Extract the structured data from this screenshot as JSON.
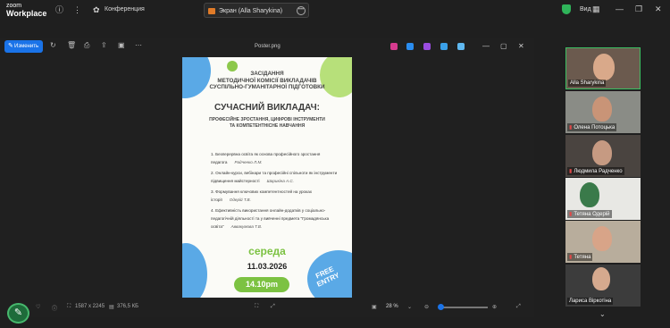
{
  "topbar": {
    "brand_line1": "zoom",
    "brand_line2": "Workplace",
    "conference_label": "Конференция",
    "tab_label": "Экран (Alla Sharykina)",
    "view_label": "Вид"
  },
  "viewer": {
    "edit_label": "Изменить",
    "file_title": "Poster.png",
    "dimensions": "1587 x 2245",
    "file_size": "376,5 КБ",
    "zoom_level": "28 %",
    "zoom_fraction": 0.28
  },
  "poster": {
    "heading_lines": [
      "ЗАСІДАННЯ",
      "МЕТОДИЧНОЇ КОМІСІЇ ВИКЛАДАЧІВ",
      "СУСПІЛЬНО-ГУМАНІТАРНОЇ ПІДГОТОВКИ"
    ],
    "title": "СУЧАСНИЙ ВИКЛАДАЧ:",
    "subtitle_lines": [
      "ПРОФЕСІЙНЕ ЗРОСТАННЯ, ЦИФРОВІ ІНСТРУМЕНТИ",
      "ТА КОМПЕТЕНТНІСНЕ НАВЧАННЯ"
    ],
    "items": [
      {
        "text": "1. Безперервна освіта як основа професійного зростання педагога",
        "sign": "Радченко Л.М."
      },
      {
        "text": "2. Онлайн-курси, вебінари та професійні спільноти як інструменти підвищення майстерності",
        "sign": "Шарикіна А.С."
      },
      {
        "text": "3. Формування ключових компетентностей на уроках історії",
        "sign": "Одерій Т.В."
      },
      {
        "text": "4. Ефективність використання онлайн-додатків у соціально-педагогічній діяльності та у вивченні предмета \"Громадянська освіта\"",
        "sign": "Аввакумова Т.В."
      }
    ],
    "day": "середа",
    "date": "11.03.2026",
    "time": "14.10pm",
    "badge_line1": "FREE",
    "badge_line2": "ENTRY"
  },
  "participants": [
    {
      "name": "Alla Sharykina",
      "muted": false
    },
    {
      "name": "Олена Потоцька",
      "muted": true
    },
    {
      "name": "Людмила Радченко",
      "muted": true
    },
    {
      "name": "Тетяна Одерій",
      "muted": true
    },
    {
      "name": "Тетяна",
      "muted": true
    },
    {
      "name": "Лариса Віркотіна",
      "muted": false
    }
  ],
  "colors": {
    "accent_blue": "#1a73e8",
    "poster_green": "#7cc242",
    "active_speaker": "#3cc062"
  }
}
